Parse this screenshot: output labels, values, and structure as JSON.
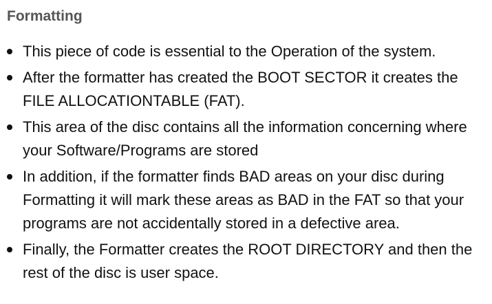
{
  "heading": "Formatting",
  "bullets": [
    "This piece of code is essential to the Operation of the system.",
    "After the formatter has created the BOOT SECTOR it creates the FILE ALLOCATIONTABLE (FAT).",
    "This area of the disc contains all the information concerning where your Software/Programs are stored",
    "In addition, if the formatter finds BAD areas on your disc during Formatting it will mark these areas as BAD in the FAT so that your programs are not accidentally stored in a defective area.",
    "Finally, the Formatter creates the ROOT DIRECTORY and then the rest of the disc is user space."
  ]
}
